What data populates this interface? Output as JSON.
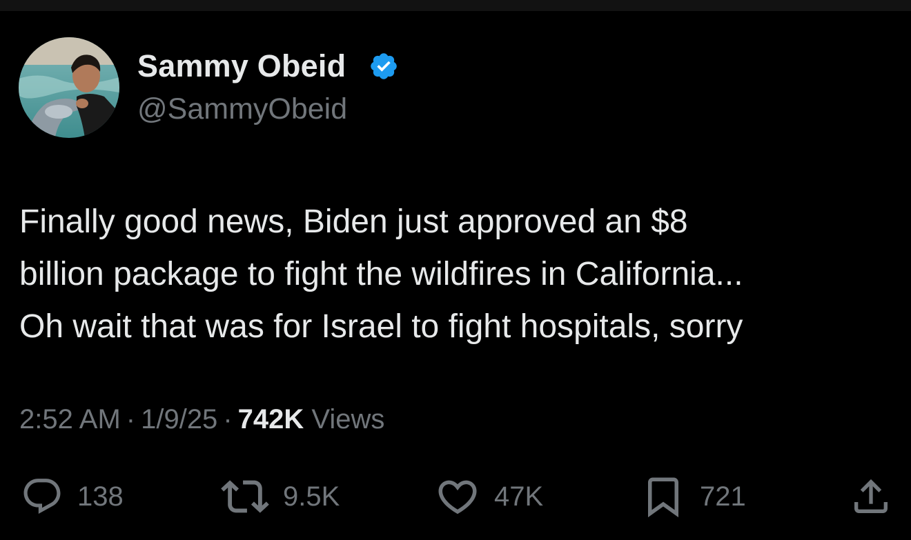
{
  "tweet": {
    "author": {
      "display_name": "Sammy Obeid",
      "handle": "@SammyObeid",
      "verified": true,
      "verified_color": "#1d9bf0"
    },
    "text_lines": [
      "Finally good news, Biden just approved an $8",
      "billion package to fight the wildfires in California...",
      "Oh wait that was for Israel to fight hospitals, sorry"
    ],
    "meta": {
      "time": "2:52 AM",
      "date": "1/9/25",
      "views_count": "742K",
      "views_label": "Views",
      "separator": "·"
    },
    "actions": {
      "reply": {
        "icon": "reply-icon",
        "count": "138"
      },
      "repost": {
        "icon": "repost-icon",
        "count": "9.5K"
      },
      "like": {
        "icon": "heart-icon",
        "count": "47K"
      },
      "bookmark": {
        "icon": "bookmark-icon",
        "count": "721"
      },
      "share": {
        "icon": "share-icon"
      }
    }
  },
  "theme": {
    "background": "#000000",
    "primary_text": "#e7e9ea",
    "secondary_text": "#71767b"
  }
}
